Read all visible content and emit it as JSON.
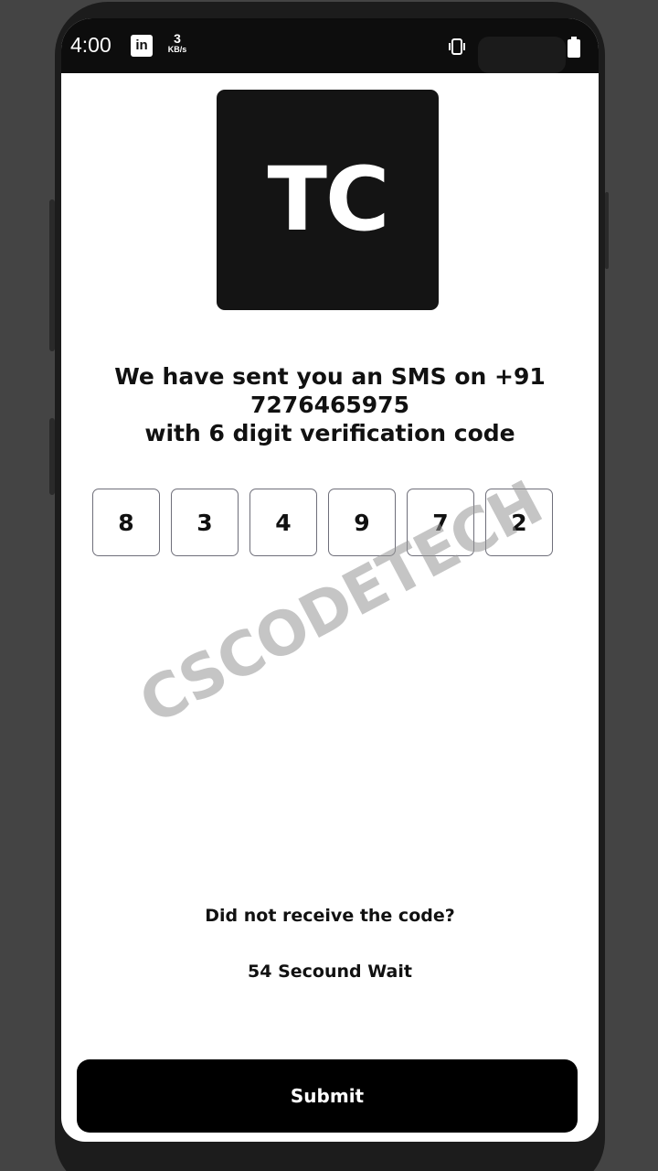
{
  "status_bar": {
    "time": "4:00",
    "app_badge": "in",
    "net_speed_value": "3",
    "net_speed_unit": "KB/s",
    "icons": [
      "linkedin-icon",
      "vibrate-icon",
      "data-arrows-icon",
      "battery-icon"
    ]
  },
  "logo": {
    "text": "TC"
  },
  "message": {
    "line1": "We have sent you an SMS on +91",
    "line2": "7276465975",
    "line3": "with 6 digit verification code"
  },
  "otp": {
    "digits": [
      "8",
      "3",
      "4",
      "9",
      "7",
      "2"
    ]
  },
  "watermark": {
    "text": "CSCODETECH"
  },
  "resend": {
    "question": "Did not receive the code?",
    "timer": "54 Secound Wait"
  },
  "submit": {
    "label": "Submit"
  },
  "colors": {
    "background": "#444444",
    "screen": "#ffffff",
    "logo_bg": "#141414",
    "button_bg": "#000000",
    "otp_border": "#6f6f7a"
  }
}
